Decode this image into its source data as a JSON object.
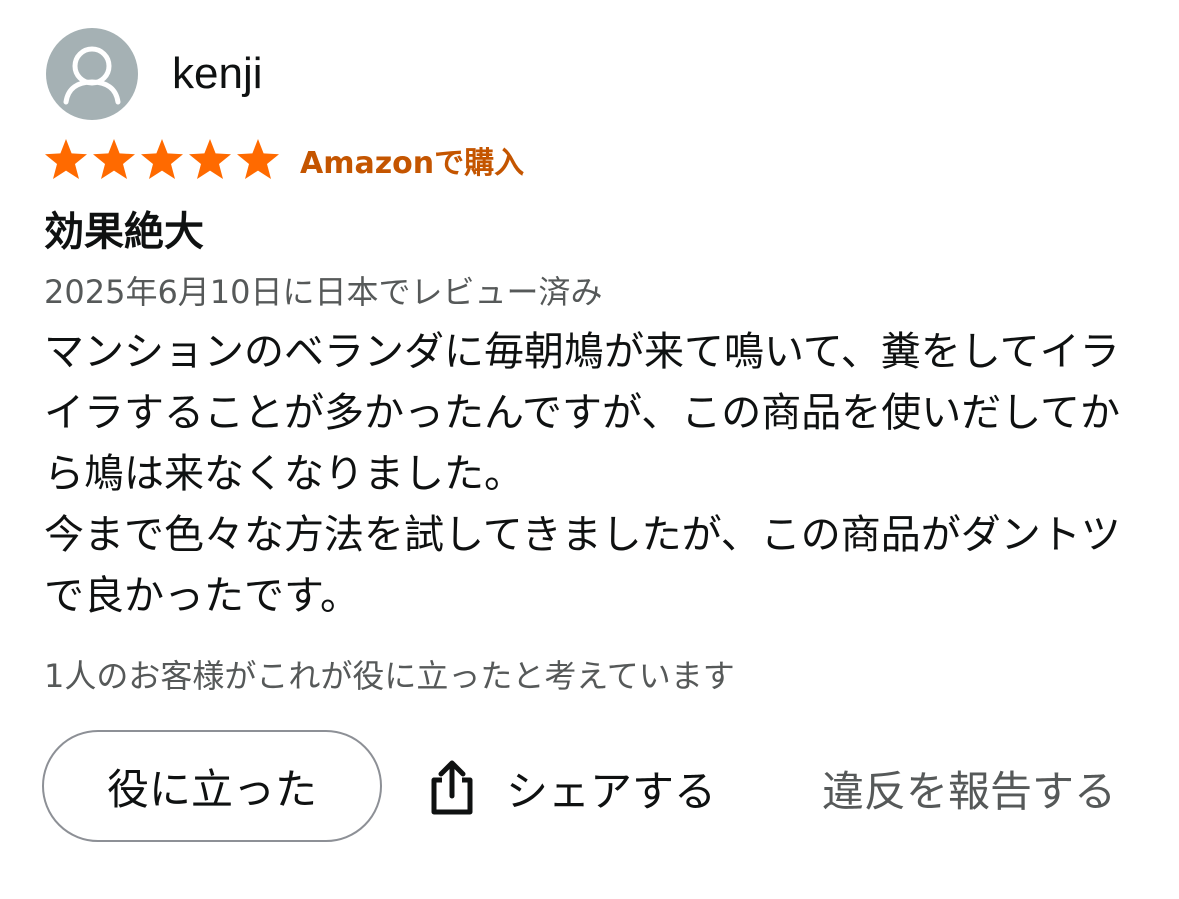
{
  "reviewer": {
    "name": "kenji",
    "avatar_icon": "user-silhouette-icon"
  },
  "rating": {
    "stars": 5,
    "max": 5,
    "star_color": "#ff6a00"
  },
  "badge": {
    "label": "Amazonで購入",
    "color": "#c45500"
  },
  "review": {
    "title": "効果絶大",
    "date": "2025年6月10日に日本でレビュー済み",
    "body": [
      "マンションのベランダに毎朝鳩が来て鳴いて、糞をしてイライラすることが多かったんですが、この商品を使いだしてから鳩は来なくなりました。",
      "今まで色々な方法を試してきましたが、この商品がダントツで良かったです。"
    ],
    "helpful_count_text": "1人のお客様がこれが役に立ったと考えています"
  },
  "actions": {
    "helpful_label": "役に立った",
    "share_label": "シェアする",
    "share_icon": "share-icon",
    "report_label": "違反を報告する"
  }
}
